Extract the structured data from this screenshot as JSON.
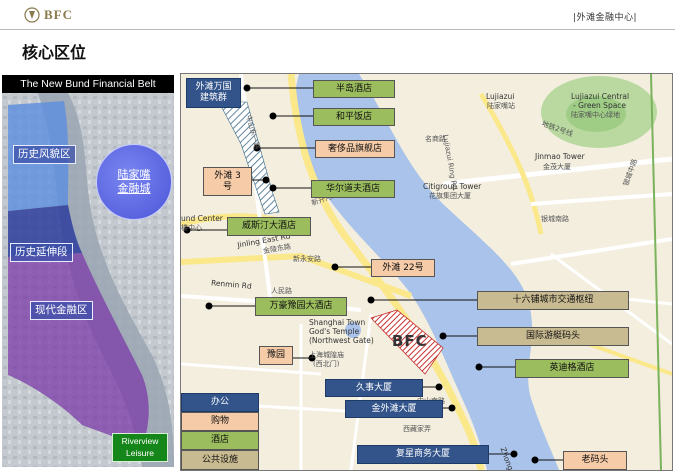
{
  "header": {
    "logo": "BFC",
    "org": "|外滩金融中心|",
    "title": "核心区位"
  },
  "left_panel": {
    "title": "The New Bund Financial Belt",
    "zones": [
      {
        "label": "历史风貌区"
      },
      {
        "label": "历史延伸段"
      },
      {
        "label": "现代金融区"
      }
    ],
    "lujiazui": [
      "陆家嘴",
      "金融城"
    ],
    "riverview": [
      "Riverview",
      "Leisure"
    ]
  },
  "map": {
    "bfc_label": "BFC",
    "callouts": [
      {
        "text": "外滩万国",
        "text2": "建筑群",
        "style": "blue"
      },
      {
        "text": "半岛酒店",
        "style": "green"
      },
      {
        "text": "和平饭店",
        "style": "green"
      },
      {
        "text": "奢侈品旗舰店",
        "style": "peach"
      },
      {
        "text": "外滩 3",
        "text2": "号",
        "style": "peach"
      },
      {
        "text": "华尔道夫酒店",
        "style": "green"
      },
      {
        "text": "威斯汀大酒店",
        "style": "green"
      },
      {
        "text": "外滩 22号",
        "style": "peach"
      },
      {
        "text": "万豪豫园大酒店",
        "style": "green"
      },
      {
        "text": "十六铺城市交通枢纽",
        "style": "tan"
      },
      {
        "text": "国际游艇码头",
        "style": "tan"
      },
      {
        "text": "豫园",
        "style": "peach"
      },
      {
        "text": "英迪格酒店",
        "style": "green"
      },
      {
        "text": "久事大厦",
        "style": "blue"
      },
      {
        "text": "金外滩大厦",
        "style": "blue"
      },
      {
        "text": "复星商务大厦",
        "style": "blue"
      },
      {
        "text": "老码头",
        "style": "peach"
      }
    ],
    "legend": [
      {
        "label": "办公",
        "style": "blue"
      },
      {
        "label": "购物",
        "style": "peach"
      },
      {
        "label": "酒店",
        "style": "green"
      },
      {
        "label": "公共设施",
        "style": "tan"
      }
    ],
    "labels": [
      "Lujiazui",
      "陆家嘴站",
      "Lujiazui Central",
      "- Green Space",
      "陆家嘴中心绿地",
      "Jinmao Tower",
      "金茂大厦",
      "Citigroup Tower",
      "花旗集团大厦",
      "Lujiazui Ring Rd",
      "银城南路",
      "银城中路",
      "地铁2号线",
      "名商路",
      "und Center",
      "楼中心",
      "Jinling East Rd",
      "金陵东路",
      "新永安路",
      "Renmin Rd",
      "人民路",
      "Shanghai Town",
      "God's Temple",
      "(Northwest Gate)",
      "上海城隍庙",
      "(西北门)",
      "中山南路",
      "西藏家弄",
      "Zhongs",
      "新开河路",
      "中山东一路"
    ]
  },
  "colors": {
    "river": "#a9c3ea",
    "green": "#9bbd5d",
    "peach": "#f6cba7",
    "tan": "#c9bb91",
    "blue": "#33548a",
    "bfc_hatch": "#c8312f",
    "road_yellow": "#fbe88a"
  }
}
